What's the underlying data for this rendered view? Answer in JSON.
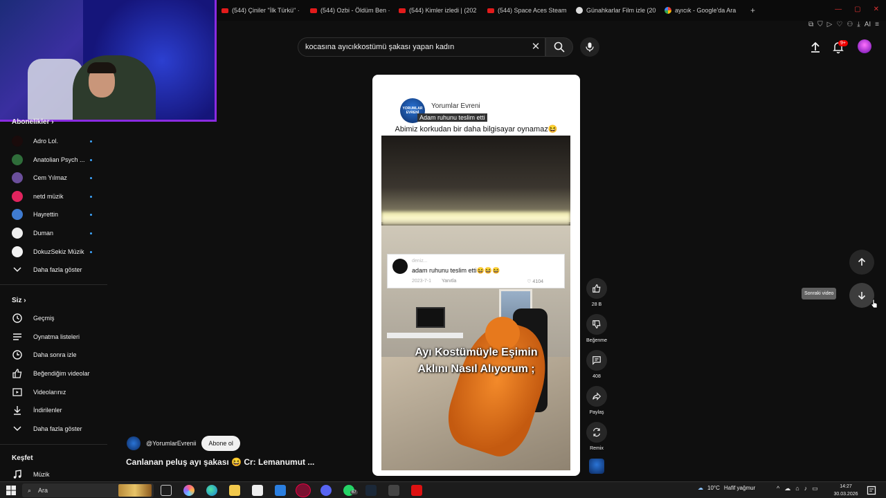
{
  "browser": {
    "tabs": [
      {
        "label": "(544) Çiniler \"İlk Türkü\" ·",
        "icon": "youtube-icon"
      },
      {
        "label": "(544) Ozbi - Öldüm Ben ·",
        "icon": "youtube-icon"
      },
      {
        "label": "(544) Kimler izledi | (202",
        "icon": "youtube-icon"
      },
      {
        "label": "(544) Space Aces Steam",
        "icon": "youtube-icon"
      },
      {
        "label": "Günahkarlar Film izle (20",
        "icon": "film-site-icon"
      },
      {
        "label": "ayıcık - Google'da Ara",
        "icon": "google-icon"
      }
    ],
    "toolbar_ai": "AI"
  },
  "header": {
    "search_value": "kocasına ayıcıkkostümü şakası yapan kadın",
    "notification_count": "9+"
  },
  "sidebar": {
    "subscriptions_title": "Abonelikler",
    "subscriptions": [
      {
        "label": "Adro Lol.",
        "color": "#1a0b0b"
      },
      {
        "label": "Anatolian Psych ...",
        "color": "#2f6d3a"
      },
      {
        "label": "Cem Yılmaz",
        "color": "#6b4f9b"
      },
      {
        "label": "netd müzik",
        "color": "#e0245e"
      },
      {
        "label": "Hayrettin",
        "color": "#3f7bd0"
      },
      {
        "label": "Duman",
        "color": "#eeeeee"
      },
      {
        "label": "DokuzSekiz Müzik",
        "color": "#f2f2f2"
      }
    ],
    "show_more_1": "Daha fazla göster",
    "you_title": "Siz",
    "you_items": [
      {
        "label": "Geçmiş",
        "icon": "history-icon"
      },
      {
        "label": "Oynatma listeleri",
        "icon": "playlist-icon"
      },
      {
        "label": "Daha sonra izle",
        "icon": "watch-later-icon"
      },
      {
        "label": "Beğendiğim videolar",
        "icon": "like-icon"
      },
      {
        "label": "Videolarınız",
        "icon": "your-videos-icon"
      },
      {
        "label": "İndirilenler",
        "icon": "download-icon"
      }
    ],
    "show_more_2": "Daha fazla göster",
    "explore_title": "Keşfet",
    "explore_items": [
      {
        "label": "Müzik",
        "icon": "music-icon"
      }
    ]
  },
  "short": {
    "channel_name": "Yorumlar Evreni",
    "logo_text": "YORUMLAR EVRENİ",
    "subtitle": "Adam ruhunu teslim etti",
    "caption": "Abimiz korkudan bir daha bilgisayar oynamaz😆",
    "comment": {
      "user": "deniz...",
      "text": "adam ruhunu teslim etti😆😆😆",
      "date": "2023-7-1",
      "reply": "Yanıtla",
      "likes": "4104"
    },
    "overlay_line1": "Ayı Kostümüyle Eşimin",
    "overlay_line2": "Aklını Nasıl Alıyorum ;"
  },
  "actions": {
    "like_count": "28 B",
    "dislike_label": "Beğenme",
    "comment_count": "408",
    "share_label": "Paylaş",
    "remix_label": "Remix"
  },
  "nav": {
    "tooltip": "Sonraki video"
  },
  "channel_row": {
    "handle": "@YorumlarEvrenii",
    "subscribe_label": "Abone ol"
  },
  "video_title": "Canlanan peluş ayı şakası 😆 Cr: Lemanumut ...",
  "taskbar": {
    "search_placeholder": "Ara",
    "weather_temp": "10°C",
    "weather_desc": "Hafif yağmur",
    "whatsapp_badge": "67",
    "time": "14:27",
    "date": "30.03.2026"
  },
  "colors": {
    "accent": "#3ea6ff",
    "webcam_border": "#8a2be2",
    "youtube_red": "#e21b1b"
  }
}
